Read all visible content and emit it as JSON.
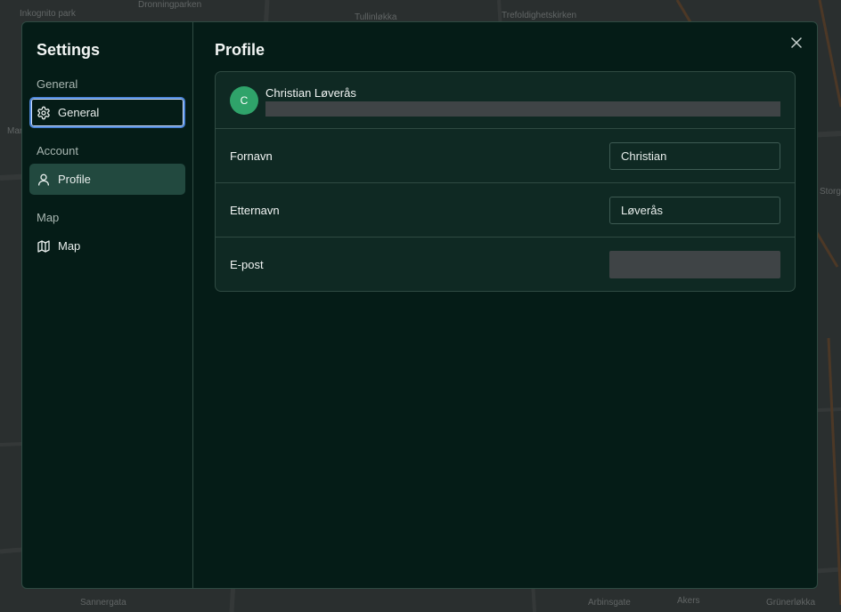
{
  "map": {
    "labels": [
      "Inkognito park",
      "Dronningparken",
      "Tullinløkka",
      "Trefoldighetskirken",
      "Mariboes",
      "Storgata",
      "Akers",
      "Grünerløkka",
      "Sannergata",
      "Arbinsgate"
    ]
  },
  "sidebar": {
    "title": "Settings",
    "sections": [
      {
        "label": "General",
        "item": {
          "label": "General",
          "icon": "gear-icon"
        }
      },
      {
        "label": "Account",
        "item": {
          "label": "Profile",
          "icon": "user-icon"
        }
      },
      {
        "label": "Map",
        "item": {
          "label": "Map",
          "icon": "map-icon"
        }
      }
    ]
  },
  "main": {
    "title": "Profile",
    "close_icon": "close-icon"
  },
  "profile": {
    "avatar_initial": "C",
    "name": "Christian Løverås",
    "fields": [
      {
        "label": "Fornavn",
        "value": "Christian"
      },
      {
        "label": "Etternavn",
        "value": "Løverås"
      },
      {
        "label": "E-post",
        "value": ""
      }
    ]
  },
  "colors": {
    "dialog_bg": "#051c17",
    "active_item": "#22493f",
    "focus_ring": "#4d86d9",
    "avatar": "#2fa36a"
  }
}
